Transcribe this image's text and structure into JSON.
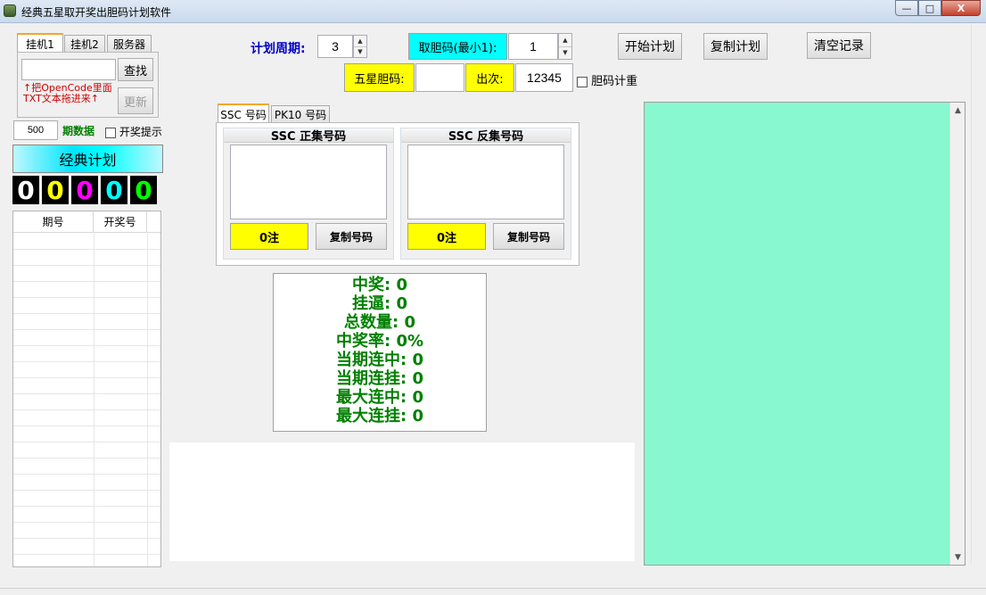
{
  "window": {
    "title": "经典五星取开奖出胆码计划软件",
    "minimize": "—",
    "maximize": "□",
    "close": "X"
  },
  "left": {
    "tabs": [
      "挂机1",
      "挂机2",
      "服务器"
    ],
    "search_value": "",
    "find_label": "查找",
    "hint_line1": "↑把OpenCode里面",
    "hint_line2": "TXT文本拖进来↑",
    "update_label": "更新",
    "period_count": "500",
    "period_label": "期数据",
    "notify_label": "开奖提示",
    "classic_plan_label": "经典计划",
    "digits": [
      {
        "value": "0",
        "color": "#ffffff"
      },
      {
        "value": "0",
        "color": "#ffff00"
      },
      {
        "value": "0",
        "color": "#ff00ff"
      },
      {
        "value": "0",
        "color": "#00ffff"
      },
      {
        "value": "0",
        "color": "#00ff00"
      }
    ],
    "grid_headers": [
      "期号",
      "开奖号"
    ]
  },
  "top": {
    "cycle_label": "计划周期:",
    "cycle_value": "3",
    "gall_label": "取胆码(最小1):",
    "gall_value": "1",
    "five_star_label": "五星胆码:",
    "five_star_value": "",
    "times_label": "出次:",
    "times_value": "12345",
    "repeat_label": "胆码计重",
    "start_plan": "开始计划",
    "copy_plan": "复制计划",
    "clear_records": "清空记录"
  },
  "center": {
    "tabs": [
      "SSC 号码",
      "PK10 号码"
    ],
    "pos_title": "SSC 正集号码",
    "neg_title": "SSC 反集号码",
    "pos_count": "0注",
    "neg_count": "0注",
    "copy_numbers": "复制号码"
  },
  "stats": {
    "lines": [
      "中奖: 0",
      "挂逼: 0",
      "总数量: 0",
      "中奖率: 0%",
      "当期连中: 0",
      "当期连挂: 0",
      "最大连中: 0",
      "最大连挂: 0"
    ]
  },
  "colors": {
    "accent_green": "#008000",
    "plan_text": "#0000cc",
    "right_panel": "#88f8d0"
  }
}
